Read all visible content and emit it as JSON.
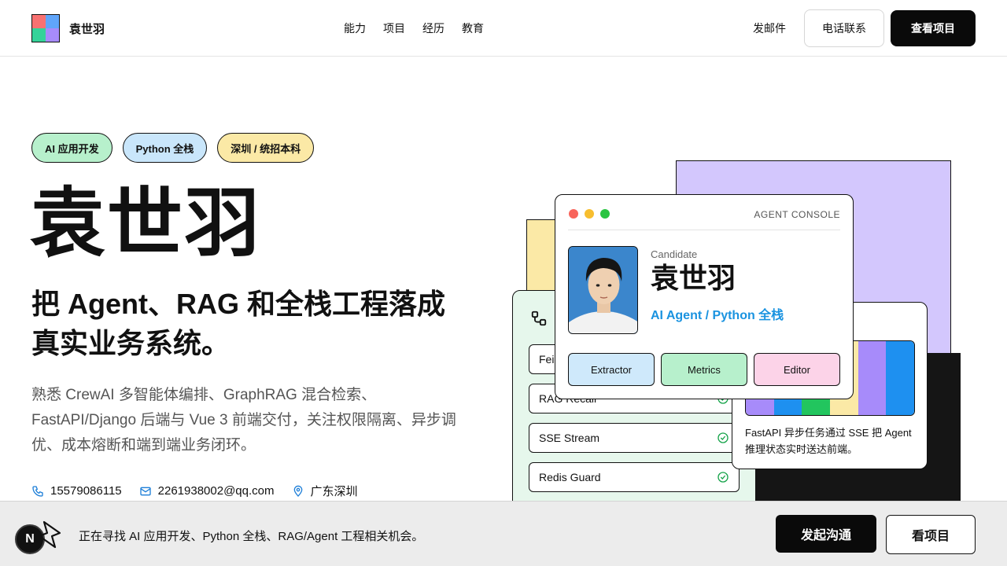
{
  "header": {
    "brand": "袁世羽",
    "nav": [
      "能力",
      "项目",
      "经历",
      "教育"
    ],
    "mail_link": "发邮件",
    "phone_button": "电话联系",
    "projects_button": "查看项目"
  },
  "hero": {
    "tags": [
      "AI 应用开发",
      "Python 全栈",
      "深圳 / 统招本科"
    ],
    "name": "袁世羽",
    "title": "把 Agent、RAG 和全栈工程落成真实业务系统。",
    "description": "熟悉 CrewAI 多智能体编排、GraphRAG 混合检索、FastAPI/Django 后端与 Vue 3 前端交付，关注权限隔离、异步调优、成本熔断和端到端业务闭环。",
    "contacts": {
      "phone": "15579086115",
      "email": "2261938002@qq.com",
      "location": "广东深圳"
    }
  },
  "console": {
    "label": "AGENT CONSOLE",
    "candidate_label": "Candidate",
    "candidate_name": "袁世羽",
    "candidate_role": "AI Agent / Python 全栈",
    "chips": [
      "Extractor",
      "Metrics",
      "Editor"
    ]
  },
  "pipeline": {
    "rows": [
      "Fei",
      "RAG Recall",
      "SSE Stream",
      "Redis Guard"
    ]
  },
  "sse_card": {
    "text": "FastAPI 异步任务通过 SSE 把 Agent 推理状态实时送达前端。",
    "bar_colors": [
      "#a78bfa",
      "#1e90f0",
      "#22c55e",
      "#fbe9a6",
      "#a78bfa",
      "#1e90f0"
    ]
  },
  "banner": {
    "badge": "N",
    "text": "正在寻找 AI 应用开发、Python 全栈、RAG/Agent 工程相关机会。",
    "contact_button": "发起沟通",
    "view_button": "看项目"
  },
  "colors": {
    "accent_blue": "#1a93e0",
    "green_tag": "#b7f0cc",
    "blue_tag": "#c9e6fb",
    "yellow_tag": "#fbe9a6",
    "purple": "#d3c7fd"
  }
}
